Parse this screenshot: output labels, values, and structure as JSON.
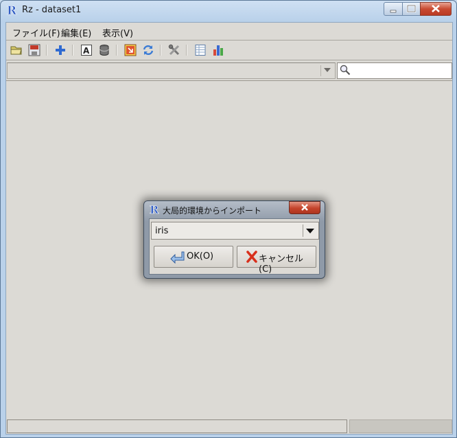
{
  "window": {
    "title": "Rz - dataset1"
  },
  "menu": [
    {
      "label": "ファイル(F)"
    },
    {
      "label": "編集(E)"
    },
    {
      "label": "表示(V)"
    }
  ],
  "toolbar": {
    "icons": [
      "open-folder-icon",
      "save-icon",
      "add-icon",
      "text-icon",
      "database-icon",
      "import-icon",
      "refresh-icon",
      "tools-icon",
      "table-icon",
      "bar-chart-icon"
    ]
  },
  "filter": {
    "value": "",
    "search_placeholder": ""
  },
  "status": {
    "left": "",
    "right": ""
  },
  "dialog": {
    "title": "大局的環境からインポート",
    "selected": "iris",
    "ok_label": "OK(O)",
    "cancel_label": "キャンセル(C)"
  },
  "colors": {
    "accent": "#2f6ad1",
    "close": "#c94b32",
    "dialog_frame": "#8f9aa8"
  }
}
